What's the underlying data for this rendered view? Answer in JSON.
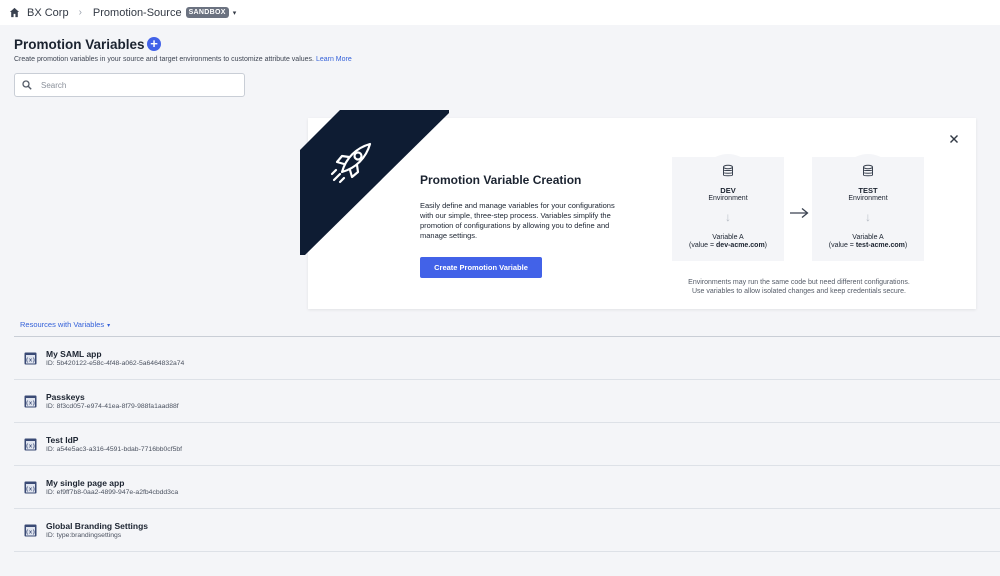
{
  "breadcrumb": {
    "home_icon": "home-icon",
    "org": "BX Corp",
    "separator": "›",
    "environment": "Promotion-Source",
    "badge": "SANDBOX",
    "caret": "▾"
  },
  "header": {
    "title": "Promotion Variables",
    "add_symbol": "+",
    "subtitle": "Create promotion variables in your source and target environments to customize attribute values.",
    "learn_more": "Learn More"
  },
  "search": {
    "placeholder": "Search"
  },
  "promo_card": {
    "title": "Promotion Variable Creation",
    "description": "Easily define and manage variables for your configurations with our simple, three-step process. Variables simplify the promotion of configurations by allowing you to define and manage settings.",
    "button_label": "Create Promotion Variable",
    "close_symbol": "✕",
    "environments": [
      {
        "name": "DEV",
        "label": "Environment",
        "arrow": "↓",
        "variable": "Variable A",
        "value_prefix": "(value = ",
        "value": "dev-acme.com",
        "value_suffix": ")"
      },
      {
        "name": "TEST",
        "label": "Environment",
        "arrow": "↓",
        "variable": "Variable A",
        "value_prefix": "(value = ",
        "value": "test-acme.com",
        "value_suffix": ")"
      }
    ],
    "note_line1": "Environments may run the same code but need different configurations.",
    "note_line2": "Use variables to allow isolated changes and keep credentials secure."
  },
  "resources": {
    "toggle_label": "Resources with Variables",
    "caret": "▾",
    "items": [
      {
        "name": "My SAML app",
        "id": "ID: 5b420122-e58c-4f48-a062-5a6464832a74"
      },
      {
        "name": "Passkeys",
        "id": "ID: 8f3cd057-e974-41ea-8f79-988fa1aad88f"
      },
      {
        "name": "Test IdP",
        "id": "ID: a54e5ac3-a316-4591-bdab-7716bb0cf5bf"
      },
      {
        "name": "My single page app",
        "id": "ID: ef9ff7b8-0aa2-4899-947e-a2fb4cbdd3ca"
      },
      {
        "name": "Global Branding Settings",
        "id": "ID: type:brandingsettings"
      }
    ]
  },
  "colors": {
    "accent": "#4262e8",
    "link": "#3461d9",
    "banner": "#0e1c33",
    "background": "#f4f5f8"
  }
}
